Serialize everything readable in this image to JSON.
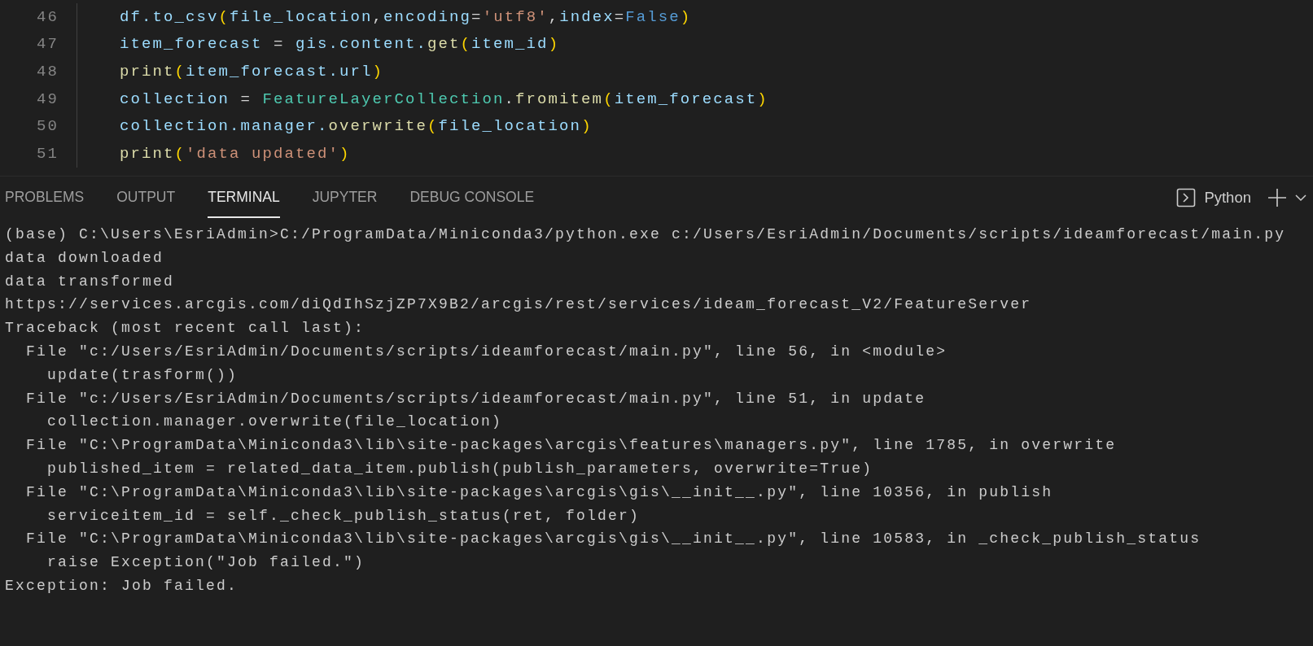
{
  "editor": {
    "lines": [
      {
        "number": "46",
        "tokens": [
          {
            "kind": "var",
            "text": "df.to_csv"
          },
          {
            "kind": "paren",
            "text": "("
          },
          {
            "kind": "var",
            "text": "file_location"
          },
          {
            "kind": "plain",
            "text": ","
          },
          {
            "kind": "var",
            "text": "encoding"
          },
          {
            "kind": "plain",
            "text": "="
          },
          {
            "kind": "string",
            "text": "'utf8'"
          },
          {
            "kind": "plain",
            "text": ","
          },
          {
            "kind": "var",
            "text": "index"
          },
          {
            "kind": "plain",
            "text": "="
          },
          {
            "kind": "constant",
            "text": "False"
          },
          {
            "kind": "paren",
            "text": ")"
          }
        ]
      },
      {
        "number": "47",
        "tokens": [
          {
            "kind": "var",
            "text": "item_forecast"
          },
          {
            "kind": "plain",
            "text": " = "
          },
          {
            "kind": "var",
            "text": "gis.content."
          },
          {
            "kind": "function",
            "text": "get"
          },
          {
            "kind": "paren",
            "text": "("
          },
          {
            "kind": "var",
            "text": "item_id"
          },
          {
            "kind": "paren",
            "text": ")"
          }
        ]
      },
      {
        "number": "48",
        "tokens": [
          {
            "kind": "function",
            "text": "print"
          },
          {
            "kind": "paren",
            "text": "("
          },
          {
            "kind": "var",
            "text": "item_forecast.url"
          },
          {
            "kind": "paren",
            "text": ")"
          }
        ]
      },
      {
        "number": "49",
        "tokens": [
          {
            "kind": "var",
            "text": "collection"
          },
          {
            "kind": "plain",
            "text": " = "
          },
          {
            "kind": "class",
            "text": "FeatureLayerCollection"
          },
          {
            "kind": "plain",
            "text": "."
          },
          {
            "kind": "function",
            "text": "fromitem"
          },
          {
            "kind": "paren",
            "text": "("
          },
          {
            "kind": "var",
            "text": "item_forecast"
          },
          {
            "kind": "paren",
            "text": ")"
          }
        ]
      },
      {
        "number": "50",
        "tokens": [
          {
            "kind": "var",
            "text": "collection.manager."
          },
          {
            "kind": "function",
            "text": "overwrite"
          },
          {
            "kind": "paren",
            "text": "("
          },
          {
            "kind": "var",
            "text": "file_location"
          },
          {
            "kind": "paren",
            "text": ")"
          }
        ]
      },
      {
        "number": "51",
        "tokens": [
          {
            "kind": "function",
            "text": "print"
          },
          {
            "kind": "paren",
            "text": "("
          },
          {
            "kind": "string",
            "text": "'data updated'"
          },
          {
            "kind": "paren",
            "text": ")"
          }
        ]
      }
    ]
  },
  "panel": {
    "tabs": [
      {
        "label": "PROBLEMS",
        "selected": false
      },
      {
        "label": "OUTPUT",
        "selected": false
      },
      {
        "label": "TERMINAL",
        "selected": true
      },
      {
        "label": "JUPYTER",
        "selected": false
      },
      {
        "label": "DEBUG CONSOLE",
        "selected": false
      }
    ],
    "terminal_name": "Python"
  },
  "terminal": {
    "lines": [
      "(base) C:\\Users\\EsriAdmin>C:/ProgramData/Miniconda3/python.exe c:/Users/EsriAdmin/Documents/scripts/ideamforecast/main.py",
      "data downloaded",
      "data transformed",
      "https://services.arcgis.com/diQdIhSzjZP7X9B2/arcgis/rest/services/ideam_forecast_V2/FeatureServer",
      "Traceback (most recent call last):",
      "  File \"c:/Users/EsriAdmin/Documents/scripts/ideamforecast/main.py\", line 56, in <module>",
      "    update(trasform())",
      "  File \"c:/Users/EsriAdmin/Documents/scripts/ideamforecast/main.py\", line 51, in update",
      "    collection.manager.overwrite(file_location)",
      "  File \"C:\\ProgramData\\Miniconda3\\lib\\site-packages\\arcgis\\features\\managers.py\", line 1785, in overwrite",
      "    published_item = related_data_item.publish(publish_parameters, overwrite=True)",
      "  File \"C:\\ProgramData\\Miniconda3\\lib\\site-packages\\arcgis\\gis\\__init__.py\", line 10356, in publish",
      "    serviceitem_id = self._check_publish_status(ret, folder)",
      "  File \"C:\\ProgramData\\Miniconda3\\lib\\site-packages\\arcgis\\gis\\__init__.py\", line 10583, in _check_publish_status",
      "    raise Exception(\"Job failed.\")",
      "Exception: Job failed."
    ]
  }
}
